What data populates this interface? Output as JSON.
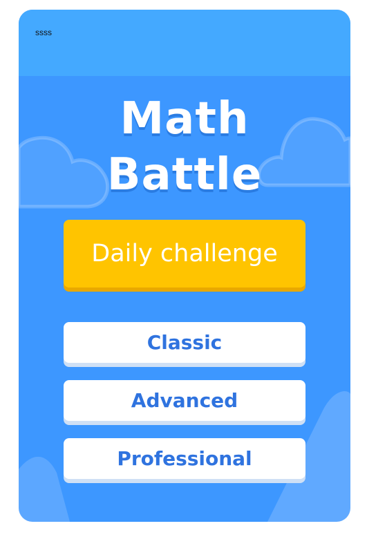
{
  "topbar": {
    "text": "ssss"
  },
  "title": {
    "line1": "Math",
    "line2": "Battle"
  },
  "buttons": {
    "daily": "Daily challenge",
    "classic": "Classic",
    "advanced": "Advanced",
    "professional": "Professional"
  },
  "colors": {
    "background": "#3d97ff",
    "topbar": "#44a9ff",
    "daily_button": "#ffc400",
    "mode_button_text": "#2f73df"
  },
  "icons": [
    "cloud-icon",
    "cloud-icon",
    "hill-icon",
    "hill-icon"
  ]
}
